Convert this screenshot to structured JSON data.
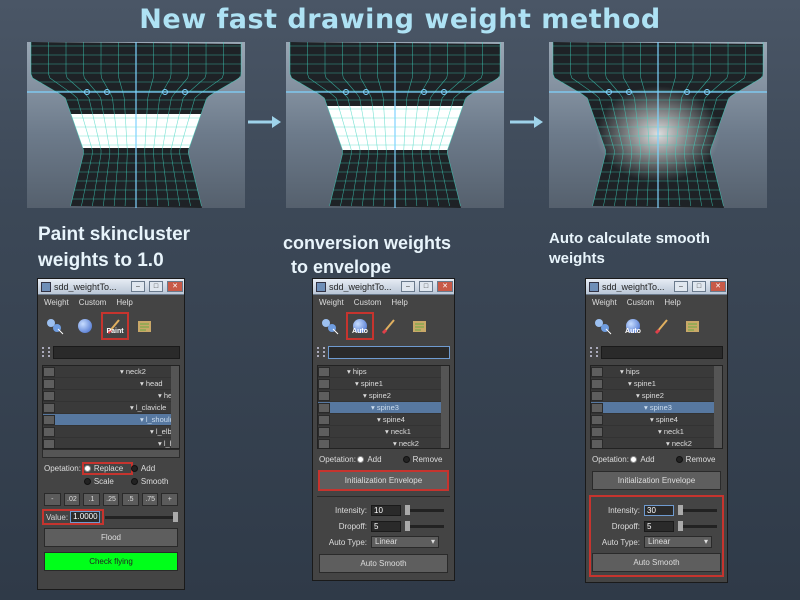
{
  "title": "New fast drawing weight method",
  "captions": {
    "step1": [
      "Paint skincluster",
      "weights to 1.0"
    ],
    "step2": [
      "conversion weights",
      "to envelope"
    ],
    "step3": [
      "Auto calculate smooth",
      "weights"
    ]
  },
  "window_title": "sdd_weightTo...",
  "menu": [
    "Weight",
    "Custom",
    "Help"
  ],
  "tools": {
    "paint_label": "Paint",
    "auto_label": "Auto"
  },
  "panel1": {
    "tree": [
      "neck2",
      "head",
      "head_End",
      "l_clavicle",
      "l_shoulder",
      "l_elbow",
      "l_hand"
    ],
    "tree_selected": 4,
    "operation_label": "Opetation:",
    "ops": [
      "Replace",
      "Add",
      "Scale",
      "Smooth"
    ],
    "op_selected": "Replace",
    "values": [
      "-",
      ".02",
      ".1",
      ".25",
      ".5",
      ".75",
      "+"
    ],
    "value_label": "Value:",
    "value": "1.0000",
    "flood": "Flood",
    "check": "Check flying"
  },
  "panel2": {
    "tree": [
      "hips",
      "spine1",
      "spine2",
      "spine3",
      "spine4",
      "neck1",
      "neck2"
    ],
    "tree_selected": 3,
    "operation_label": "Opetation:",
    "ops": [
      "Add",
      "Remove"
    ],
    "init_button": "Initialization Envelope",
    "intensity_label": "Intensity:",
    "intensity": "10",
    "dropoff_label": "Dropoff:",
    "dropoff": "5",
    "autotype_label": "Auto Type:",
    "autotype": "Linear",
    "smooth_button": "Auto Smooth"
  },
  "panel3": {
    "tree": [
      "hips",
      "spine1",
      "spine2",
      "spine3",
      "spine4",
      "neck1",
      "neck2"
    ],
    "tree_selected": 3,
    "operation_label": "Opetation:",
    "ops": [
      "Add",
      "Remove"
    ],
    "init_button": "Initialization Envelope",
    "intensity_label": "Intensity:",
    "intensity": "30",
    "dropoff_label": "Dropoff:",
    "dropoff": "5",
    "autotype_label": "Auto Type:",
    "autotype": "Linear",
    "smooth_button": "Auto Smooth"
  },
  "colors": {
    "title": "#aee2f4",
    "highlight": "#c6342e",
    "mesh": "#3fd6c0",
    "green_button": "#00ff1a"
  }
}
